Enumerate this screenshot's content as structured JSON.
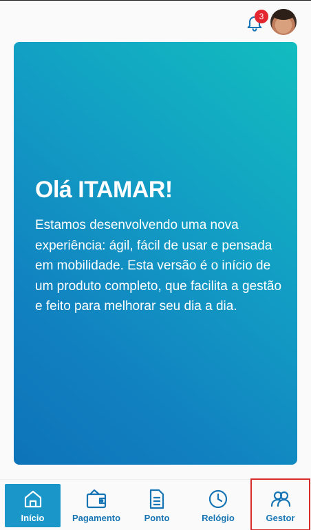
{
  "header": {
    "notifications_count": "3",
    "avatar_alt": "avatar"
  },
  "hero": {
    "title": "Olá ITAMAR!",
    "text": "Estamos desenvolvendo uma nova experiência: ágil, fácil de usar e pensada em mobilidade. Esta versão é o início de um produto completo, que facilita a gestão e feito para melhorar seu dia a dia."
  },
  "nav": {
    "items": [
      {
        "label": "Início",
        "icon": "home-icon",
        "active": true
      },
      {
        "label": "Pagamento",
        "icon": "wallet-icon",
        "active": false
      },
      {
        "label": "Ponto",
        "icon": "document-icon",
        "active": false
      },
      {
        "label": "Relógio",
        "icon": "clock-icon",
        "active": false
      },
      {
        "label": "Gestor",
        "icon": "users-icon",
        "active": false
      }
    ]
  },
  "colors": {
    "accent": "#1574b3",
    "active_tab": "#1a96c8",
    "badge": "#e3262f",
    "hero_gradient_start": "#12bdbf",
    "hero_gradient_end": "#0d73b9"
  }
}
